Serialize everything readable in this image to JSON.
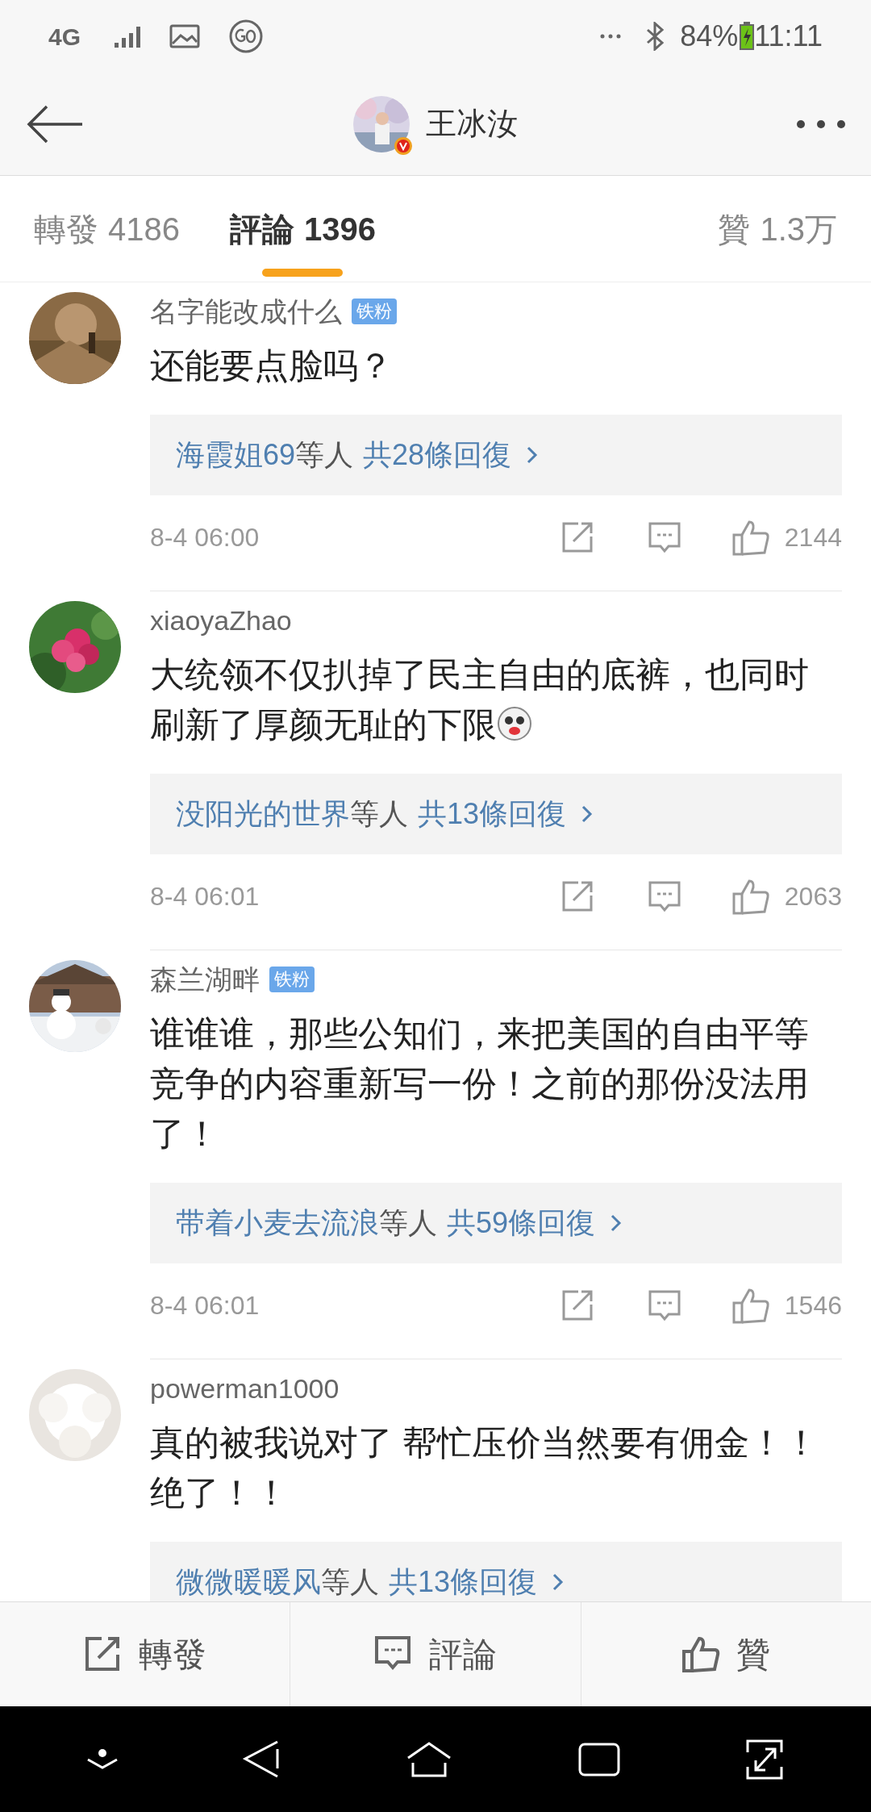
{
  "status_bar": {
    "network": "4G",
    "battery_percent": "84%",
    "time": "11:11"
  },
  "header": {
    "title": "王冰汝",
    "verified": true
  },
  "tabs": [
    {
      "label": "轉發",
      "count": "4186",
      "selected": false
    },
    {
      "label": "評論",
      "count": "1396",
      "selected": true
    },
    {
      "label": "贊",
      "count": "1.3万",
      "selected": false
    }
  ],
  "comments": [
    {
      "user": "名字能改成什么",
      "badge": "铁粉",
      "text": "还能要点脸吗？",
      "sticker": false,
      "replies": {
        "names": "海霞姐69",
        "others": "等人",
        "count": "共28條回復"
      },
      "time": "8-4 06:00",
      "likes": "2144"
    },
    {
      "user": "xiaoyaZhao",
      "text": "大统领不仅扒掉了民主自由的底裤，也同时刷新了厚颜无耻的下限",
      "sticker": true,
      "replies": {
        "names": "没阳光的世界",
        "others": "等人",
        "count": "共13條回復"
      },
      "time": "8-4 06:01",
      "likes": "2063"
    },
    {
      "user": "森兰湖畔",
      "badge": "铁粉",
      "text": "谁谁谁，那些公知们，来把美国的自由平等竞争的内容重新写一份！之前的那份没法用了！",
      "sticker": false,
      "replies": {
        "names": "带着小麦去流浪",
        "others": "等人",
        "count": "共59條回復"
      },
      "time": "8-4 06:01",
      "likes": "1546"
    },
    {
      "user": "powerman1000",
      "text": "真的被我说对了 帮忙压价当然要有佣金！！绝了！！",
      "sticker": false,
      "replies": {
        "names": "微微暖暖风",
        "others": "等人",
        "count": "共13條回復"
      }
    }
  ],
  "action_bar": [
    {
      "kind": "repost",
      "label": "轉發"
    },
    {
      "kind": "comment",
      "label": "評論"
    },
    {
      "kind": "like",
      "label": "贊"
    }
  ]
}
